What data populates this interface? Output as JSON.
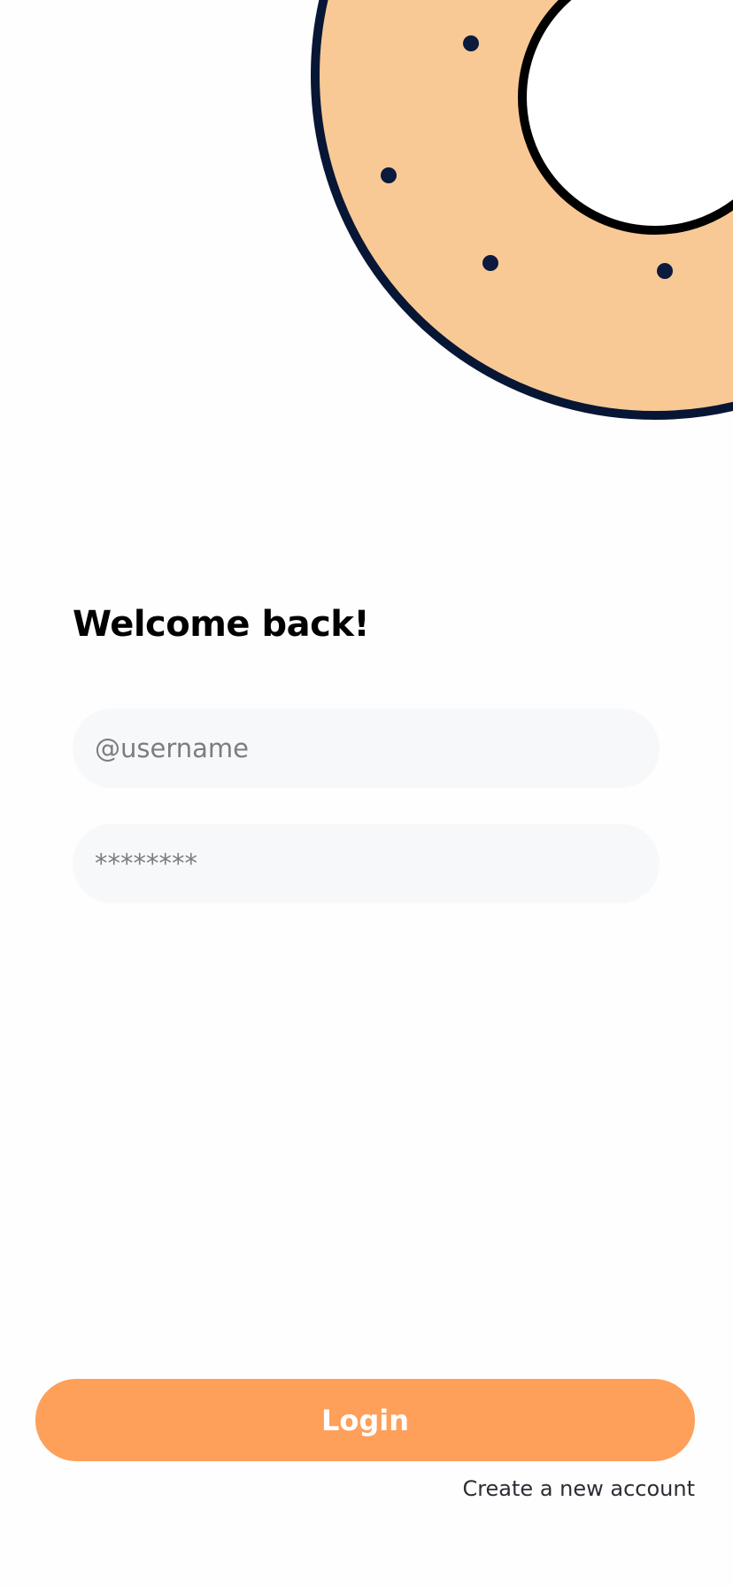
{
  "header": {
    "illustration_icon": "donut-icon",
    "colors": {
      "dough": "#f8c995",
      "outline": "#071634",
      "sprinkle": "#0b1a3d"
    }
  },
  "login_form": {
    "title": "Welcome back!",
    "username_placeholder": "@username",
    "password_placeholder": "********",
    "login_label": "Login",
    "create_account_label": "Create a new account"
  },
  "theme": {
    "accent": "#fea05a",
    "input_background": "#f7f8fa"
  }
}
